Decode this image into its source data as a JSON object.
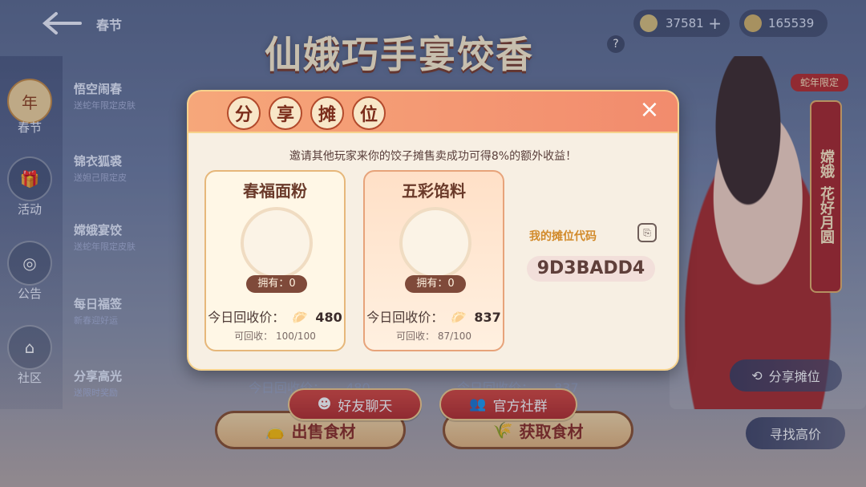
{
  "breadcrumb": {
    "title": "春节"
  },
  "resources": [
    {
      "icon": "dumpling-coin-icon",
      "value": "37581",
      "plus": "+"
    },
    {
      "icon": "gold-coin-stack-icon",
      "value": "165539"
    }
  ],
  "event": {
    "title": "仙娥巧手宴饺香",
    "help": "?"
  },
  "left_nav": [
    {
      "id": "spring",
      "label": "春节",
      "icon_text": "年",
      "active": true
    },
    {
      "id": "activity",
      "label": "活动"
    },
    {
      "id": "notice",
      "label": "公告"
    },
    {
      "id": "community",
      "label": "社区"
    }
  ],
  "sub_nav": [
    {
      "title": "悟空闹春",
      "subtitle": "送蛇年限定皮肤"
    },
    {
      "title": "锦衣狐裘",
      "subtitle": "送妲己限定皮"
    },
    {
      "title": "嫦娥宴饺",
      "subtitle": "送蛇年限定皮肤"
    },
    {
      "title": "每日福签",
      "subtitle": "新春迎好运"
    },
    {
      "title": "分享高光",
      "subtitle": "送限时奖励"
    }
  ],
  "right_side": {
    "limited_tag": "蛇年限定",
    "vertical_banner_top": "嫦娥",
    "vertical_banner_bottom": "花好月圆",
    "share_stall_button": "分享摊位",
    "find_high_price_button": "寻找高价"
  },
  "modal": {
    "title_chars": [
      "分",
      "享",
      "摊",
      "位"
    ],
    "close": "×",
    "invite_text": "邀请其他玩家来你的饺子摊售卖成功可得8%的额外收益！",
    "cards": [
      {
        "name": "春福面粉",
        "icon": "flour-sack-icon",
        "owned": "拥有：0",
        "price_label": "今日回收价：",
        "price": "480",
        "recover_label": "可回收：",
        "recover_value": "100/100"
      },
      {
        "name": "五彩馅料",
        "icon": "filling-bowl-icon",
        "owned": "拥有：0",
        "price_label": "今日回收价：",
        "price": "837",
        "recover_label": "可回收：",
        "recover_value": "87/100"
      }
    ],
    "my_code_label": "我的摊位代码",
    "my_code": "9D3BADD4"
  },
  "underlay": {
    "price_left": "今日回收价：",
    "price_left_value": "480",
    "price_right": "今日回收价：",
    "price_right_value": "837",
    "sell_btn": "出售食材",
    "get_btn": "获取食材"
  },
  "chat_buttons": {
    "friend_chat": "好友聊天",
    "official_group": "官方社群"
  }
}
